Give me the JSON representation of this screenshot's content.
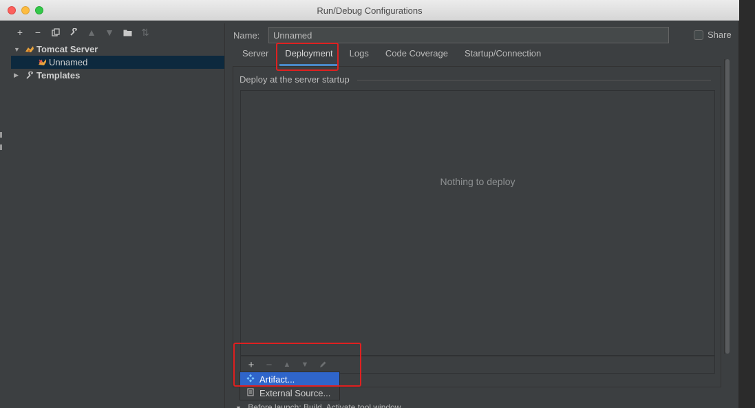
{
  "window": {
    "title": "Run/Debug Configurations"
  },
  "left_toolbar": {
    "icons": [
      "add-icon",
      "remove-icon",
      "copy-icon",
      "wrench-icon",
      "move-up-icon",
      "move-down-icon",
      "folder-icon",
      "sort-icon"
    ]
  },
  "tree": {
    "tomcat_label": "Tomcat Server",
    "unnamed_label": "Unnamed",
    "templates_label": "Templates"
  },
  "form": {
    "name_label": "Name:",
    "name_value": "Unnamed",
    "share_label": "Share",
    "share_checked": false
  },
  "tabs": [
    "Server",
    "Deployment",
    "Logs",
    "Code Coverage",
    "Startup/Connection"
  ],
  "active_tab": "Deployment",
  "deploy": {
    "group_title": "Deploy at the server startup",
    "empty_text": "Nothing to deploy"
  },
  "popup": {
    "items": [
      {
        "label": "Artifact...",
        "icon": "artifact-icon",
        "selected": true
      },
      {
        "label": "External Source...",
        "icon": "file-icon",
        "selected": false
      }
    ]
  },
  "before_launch": "Before launch: Build, Activate tool window",
  "colors": {
    "highlight": "#e02020",
    "selection": "#2f65ca",
    "tree_selection": "#0d293e",
    "tab_underline": "#4a88c7"
  }
}
